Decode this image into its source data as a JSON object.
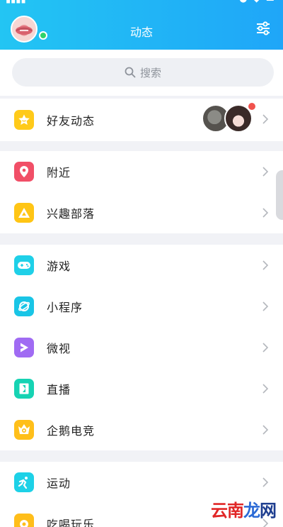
{
  "header": {
    "title": "动态",
    "settings_icon": "sliders-icon",
    "avatar": "user-avatar",
    "online_color": "#30d36b"
  },
  "search": {
    "placeholder": "搜索"
  },
  "friend_feed": {
    "label": "好友动态",
    "icon": "star-icon",
    "icon_color": "#ffca1a",
    "notification_color": "#f0524d"
  },
  "sections": [
    {
      "items": [
        {
          "label": "附近",
          "icon": "location-pin-icon",
          "color": "#f14f67"
        },
        {
          "label": "兴趣部落",
          "icon": "triangle-icon",
          "color": "#ffc515"
        }
      ]
    },
    {
      "items": [
        {
          "label": "游戏",
          "icon": "gamepad-icon",
          "color": "#1fd0e8"
        },
        {
          "label": "小程序",
          "icon": "orbit-icon",
          "color": "#19c5e6"
        },
        {
          "label": "微视",
          "icon": "play-icon",
          "color": "#a06bf3"
        },
        {
          "label": "直播",
          "icon": "live-icon",
          "color": "#16d3b3"
        },
        {
          "label": "企鹅电竞",
          "icon": "esports-crown-icon",
          "color": "#ffbf1a"
        }
      ]
    },
    {
      "items": [
        {
          "label": "运动",
          "icon": "runner-icon",
          "color": "#1dd1e7"
        },
        {
          "label": "吃喝玩乐",
          "icon": "food-icon",
          "color": "#ffbe1a"
        }
      ]
    }
  ],
  "watermark": {
    "chars": [
      "云",
      "南",
      "龙",
      "网"
    ]
  }
}
